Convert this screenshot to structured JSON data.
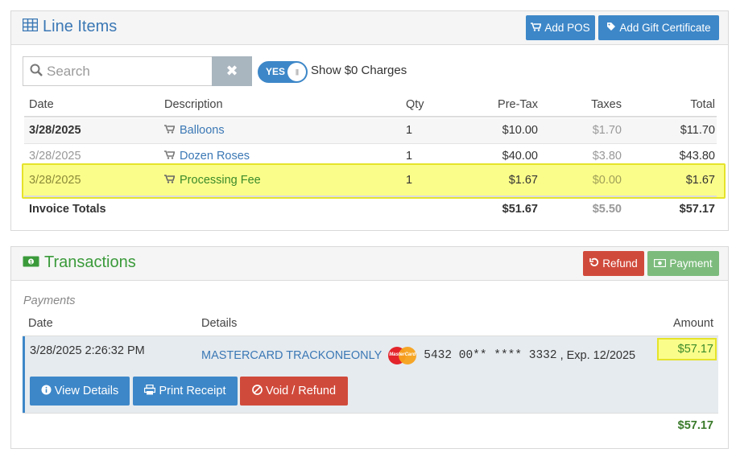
{
  "line_items": {
    "title": "Line Items",
    "add_pos_label": "Add POS",
    "add_gift_label": "Add Gift Certificate",
    "search_placeholder": "Search",
    "clear_symbol": "✖",
    "toggle_label": "YES",
    "toggle_text": "Show $0 Charges",
    "columns": {
      "date": "Date",
      "description": "Description",
      "qty": "Qty",
      "pretax": "Pre-Tax",
      "taxes": "Taxes",
      "total": "Total"
    },
    "rows": [
      {
        "date": "3/28/2025",
        "description": "Balloons",
        "qty": "1",
        "pretax": "$10.00",
        "taxes": "$1.70",
        "total": "$11.70"
      },
      {
        "date": "3/28/2025",
        "description": "Dozen Roses",
        "qty": "1",
        "pretax": "$40.00",
        "taxes": "$3.80",
        "total": "$43.80"
      },
      {
        "date": "3/28/2025",
        "description": "Processing Fee",
        "qty": "1",
        "pretax": "$1.67",
        "taxes": "$0.00",
        "total": "$1.67"
      }
    ],
    "totals": {
      "label": "Invoice Totals",
      "pretax": "$51.67",
      "taxes": "$5.50",
      "total": "$57.17"
    }
  },
  "transactions": {
    "title": "Transactions",
    "refund_label": "Refund",
    "payment_label": "Payment",
    "caption": "Payments",
    "columns": {
      "date": "Date",
      "details": "Details",
      "amount": "Amount"
    },
    "payment": {
      "datetime": "3/28/2025 2:26:32 PM",
      "card_name": "MASTERCARD TRACKONEONLY",
      "card_logo_text": "MasterCard",
      "card_number": "5432 00** **** 3332",
      "expiry": ", Exp. 12/2025",
      "amount": "$57.17"
    },
    "actions": {
      "view_details": "View Details",
      "print_receipt": "Print Receipt",
      "void_refund": "Void / Refund"
    },
    "total": "$57.17"
  },
  "colors": {
    "primary": "#3d87c8",
    "danger": "#d04a3b",
    "success": "#7cbb7c",
    "highlight": "#fbfd8a"
  }
}
